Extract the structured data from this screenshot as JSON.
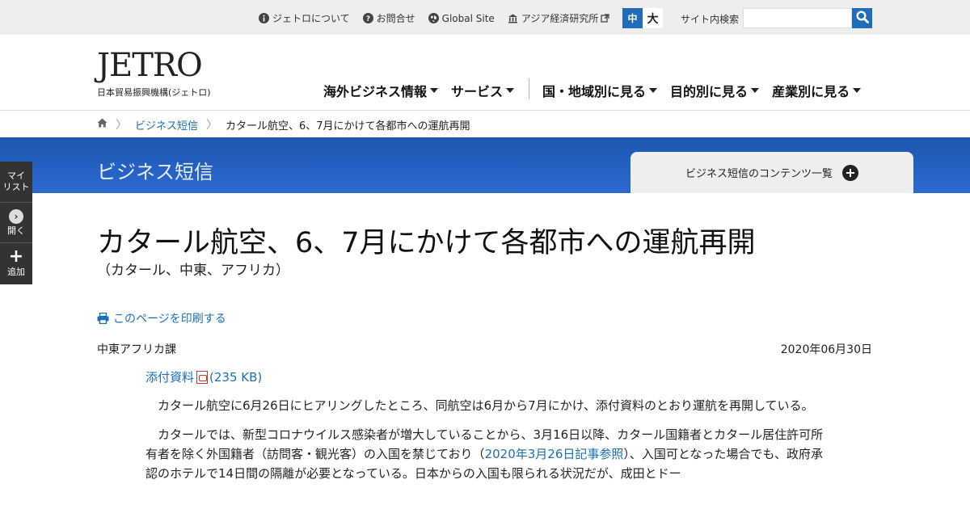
{
  "utility": {
    "links": [
      {
        "label": "ジェトロについて",
        "icon": "info-icon"
      },
      {
        "label": "お問合せ",
        "icon": "question-icon"
      },
      {
        "label": "Global Site",
        "icon": "globe-icon"
      },
      {
        "label": "アジア経済研究所",
        "icon": "building-icon"
      }
    ],
    "font_size_mid": "中",
    "font_size_large": "大",
    "search_label": "サイト内検索",
    "search_value": ""
  },
  "header": {
    "logo_text": "JETRO",
    "logo_sub": "日本貿易振興機構(ジェトロ)",
    "nav": [
      {
        "label": "海外ビジネス情報"
      },
      {
        "label": "サービス"
      },
      {
        "label": "国・地域別に見る"
      },
      {
        "label": "目的別に見る"
      },
      {
        "label": "産業別に見る"
      }
    ]
  },
  "breadcrumb": {
    "items": [
      "ビジネス短信",
      "カタール航空、6、7月にかけて各都市への運航再開"
    ]
  },
  "banner": {
    "title": "ビジネス短信",
    "contents_tab": "ビジネス短信のコンテンツ一覧"
  },
  "sidepanel": {
    "mylist": "マイ\nリスト",
    "open": "開く",
    "add": "追加"
  },
  "article": {
    "title": "カタール航空、6、7月にかけて各都市への運航再開",
    "subtitle": "（カタール、中東、アフリカ）",
    "print_label": "このページを印刷する",
    "department": "中東アフリカ課",
    "date": "2020年06月30日",
    "attachment_label": "添付資料",
    "attachment_size": "(235 KB)",
    "para1": "カタール航空に6月26日にヒアリングしたところ、同航空は6月から7月にかけ、添付資料のとおり運航を再開している。",
    "para2_a": "カタールでは、新型コロナウイルス感染者が増大していることから、3月16日以降、カタール国籍者とカタール居住許可所有者を除く外国籍者（訪問客・観光客）の入国を禁じており（",
    "para2_link": "2020年3月26日記事参照",
    "para2_b": "）、入国可となった場合でも、政府承認のホテルで14日間の隔離が必要となっている。日本からの入国も限られる状況だが、成田とドー"
  }
}
